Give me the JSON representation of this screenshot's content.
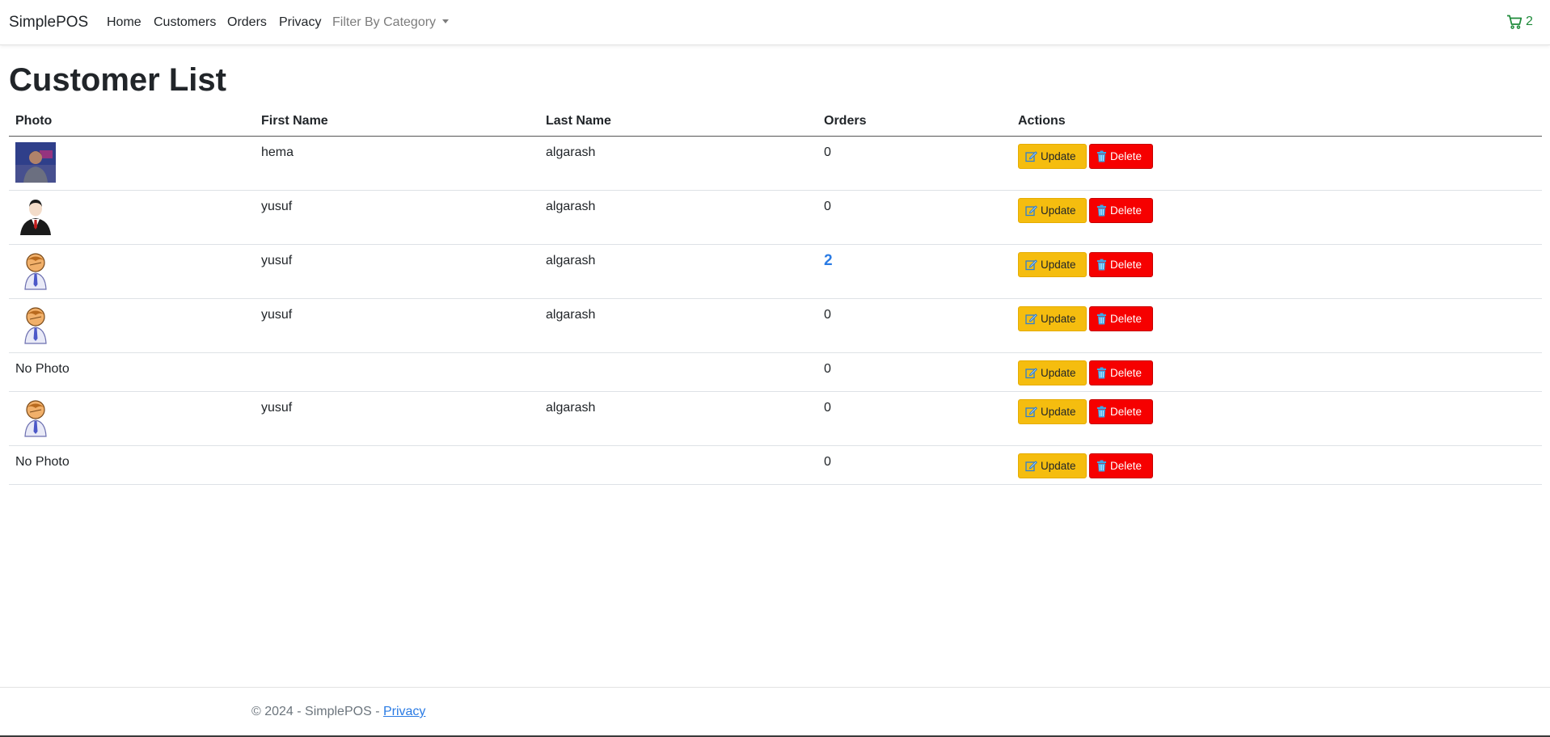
{
  "navbar": {
    "brand": "SimplePOS",
    "links": [
      "Home",
      "Customers",
      "Orders",
      "Privacy"
    ],
    "dropdown_label": "Filter By Category",
    "cart_count": "2",
    "cart_color": "#1e8a3a"
  },
  "page": {
    "title": "Customer List"
  },
  "table": {
    "columns": [
      "Photo",
      "First Name",
      "Last Name",
      "Orders",
      "Actions"
    ],
    "update_label": "Update",
    "delete_label": "Delete",
    "rows": [
      {
        "photo": "photo-image",
        "photo_text": "",
        "first": "hema",
        "last": "algarash",
        "orders": "0"
      },
      {
        "photo": "businessman-avatar-icon",
        "photo_text": "",
        "first": "yusuf",
        "last": "algarash",
        "orders": "0"
      },
      {
        "photo": "user-avatar-icon",
        "photo_text": "",
        "first": "yusuf",
        "last": "algarash",
        "orders": "2"
      },
      {
        "photo": "user-avatar-icon",
        "photo_text": "",
        "first": "yusuf",
        "last": "algarash",
        "orders": "0"
      },
      {
        "photo": "none",
        "photo_text": "No Photo",
        "first": "",
        "last": "",
        "orders": "0"
      },
      {
        "photo": "user-avatar-icon",
        "photo_text": "",
        "first": "yusuf",
        "last": "algarash",
        "orders": "0"
      },
      {
        "photo": "none",
        "photo_text": "No Photo",
        "first": "",
        "last": "",
        "orders": "0"
      }
    ]
  },
  "footer": {
    "text": "© 2024 - SimplePOS - ",
    "link_label": "Privacy"
  },
  "colors": {
    "update_button": "#f5bd0f",
    "delete_button": "#f60000",
    "link": "#2a7be4"
  }
}
